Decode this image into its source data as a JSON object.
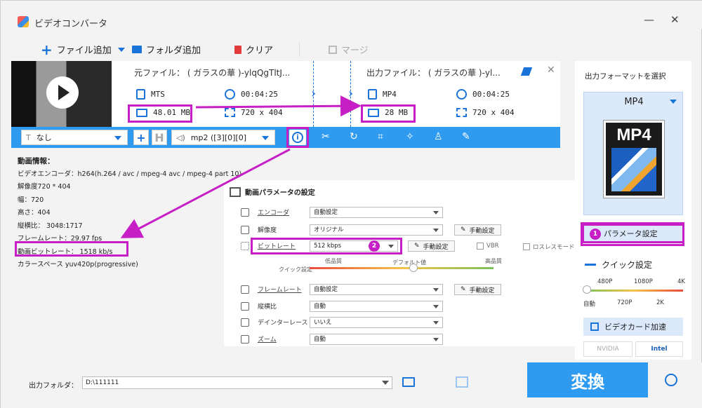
{
  "app": {
    "title": "ビデオコンバータ",
    "minimize": "—",
    "close": "✕"
  },
  "toolbar": {
    "add_file": "ファイル追加",
    "add_folder": "フォルダ追加",
    "clear": "クリア",
    "merge": "マージ"
  },
  "file": {
    "source_title": "元ファイル： ( ガラスの華 )-ylqQgTltJ...",
    "output_title": "出力ファイル： ( ガラスの華 )-yl...",
    "source": {
      "format": "MTS",
      "duration": "00:04:25",
      "size": "48.01 MB",
      "resolution": "720 x 404"
    },
    "output": {
      "format": "MP4",
      "duration": "00:04:25",
      "size": "28 MB",
      "resolution": "720 x 404"
    }
  },
  "editbar": {
    "subtitle": "なし",
    "audio": "mp2 ([3][0][0]"
  },
  "video_info": {
    "title": "動画情報：",
    "lines": [
      "ビデオエンコーダ：h264(h.264 / avc / mpeg-4 avc / mpeg-4 part 10)",
      "解像度720 * 404",
      "幅：720",
      "高さ：404",
      "縦横比： 3048:1717",
      "フレームレート：29.97 fps",
      "動画ビットレート： 1518 kb/s",
      "カラースペース yuv420p(progressive)"
    ]
  },
  "params": {
    "title": "動画パラメータの設定",
    "encoder": {
      "label": "エンコーダ",
      "value": "自動設定"
    },
    "resolution": {
      "label": "解像度",
      "value": "オリジナル",
      "manual": "手動設定"
    },
    "bitrate": {
      "label": "ビットレート",
      "value": "512 kbps",
      "manual": "手動設定",
      "vbr": "VBR",
      "lossless": "ロスレスモード"
    },
    "quick": {
      "label": "クイック設定",
      "low": "低品質",
      "default": "デフォルト値",
      "high": "高品質"
    },
    "framerate": {
      "label": "フレームレート",
      "value": "自動設定",
      "manual": "手動設定"
    },
    "aspect": {
      "label": "縦横比",
      "value": "自動"
    },
    "deinterlace": {
      "label": "デインターレース",
      "value": "いいえ"
    },
    "zoom": {
      "label": "ズーム",
      "value": "自動"
    }
  },
  "right": {
    "select_format": "出力フォーマットを選択",
    "format": "MP4",
    "format_icon_label": "MP4",
    "param_settings": "パラメータ設定",
    "badge1": "1",
    "badge2": "2",
    "quick_settings": "クイック設定",
    "q_top": [
      "480P",
      "1080P",
      "4K"
    ],
    "q_bottom": [
      "自動",
      "720P",
      "2K"
    ],
    "gpu": "ビデオカード加速",
    "nvidia": "NVIDIA",
    "intel": "Intel"
  },
  "bottom": {
    "output_folder_label": "出力フォルダ：",
    "output_folder": "D:\\111111",
    "convert": "変換"
  },
  "colors": {
    "accent": "#2e9bf0",
    "highlight": "#c61fc6",
    "panel": "#dbe9fb"
  },
  "icons": [
    "app-logo-icon",
    "plus-icon",
    "folder-icon",
    "trash-icon",
    "merge-icon",
    "play-icon",
    "file-icon",
    "clock-icon",
    "resolution-icon",
    "pencil-icon",
    "info-icon",
    "scissors-icon",
    "rotate-icon",
    "crop-icon",
    "effect-icon",
    "watermark-icon",
    "subtitle-edit-icon",
    "alarm-icon"
  ]
}
